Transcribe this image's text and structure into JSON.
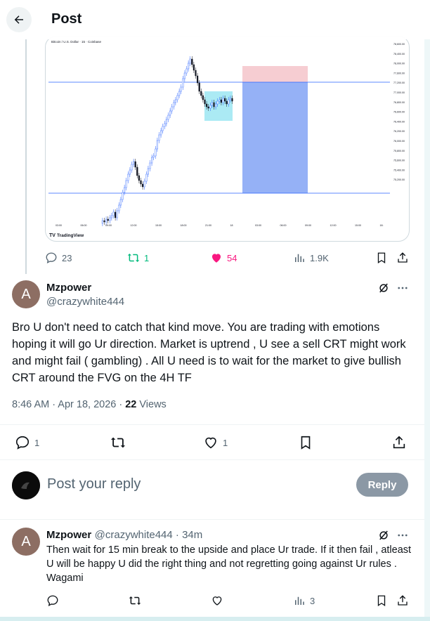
{
  "header": {
    "title": "Post"
  },
  "chart": {
    "symbol_line": "Bitcoin / U.S. Dollar · 15 · Coinbase",
    "brand": "TradingView",
    "y_ticks": [
      "78,600.00",
      "78,400.00",
      "78,000.00",
      "77,600.00",
      "77,200.00",
      "77,000.00",
      "76,800.00",
      "76,600.00",
      "76,400.00",
      "76,200.00",
      "76,000.00",
      "75,800.00",
      "75,600.00",
      "75,400.00",
      "75,200.00"
    ],
    "x_ticks": [
      "03:00",
      "06:00",
      "09:00",
      "12:00",
      "15:00",
      "18:00",
      "21:00",
      "18",
      "03:00",
      "06:00",
      "09:00",
      "12:00",
      "15:00",
      "18:"
    ],
    "colors": {
      "up": "#2962ff",
      "down": "#131722",
      "tp_zone": "#f6cdd2",
      "sl_zone": "#8aa8f5",
      "fvg_box": "#8fe3f0",
      "hline": "#2962ff"
    }
  },
  "original_post_actions": {
    "replies": "23",
    "reposts": "1",
    "likes": "54",
    "views": "1.9K"
  },
  "main_post": {
    "avatar_letter": "A",
    "name": "Mzpower",
    "handle": "@crazywhite444",
    "text": "Bro U don't need to catch that kind move. You are trading with emotions hoping it will go Ur direction. Market is uptrend , U see a sell CRT might work and might fail ( gambling) . All U need is to wait for the market to give bullish CRT around the FVG on the 4H TF",
    "timestamp": "8:46 AM · Apr 18, 2026 · ",
    "views_count": "22",
    "views_label": " Views",
    "actions": {
      "replies": "1",
      "likes": "1"
    }
  },
  "reply_composer": {
    "placeholder": "Post your reply",
    "button": "Reply"
  },
  "reply": {
    "avatar_letter": "A",
    "name": "Mzpower",
    "handle_time": "@crazywhite444 · 34m",
    "text": "Then wait for 15 min break to the upside and place Ur trade. If it then fail , atleast U will be happy U did the right thing and not regretting going against Ur rules . Wagami",
    "actions": {
      "views": "3"
    }
  }
}
